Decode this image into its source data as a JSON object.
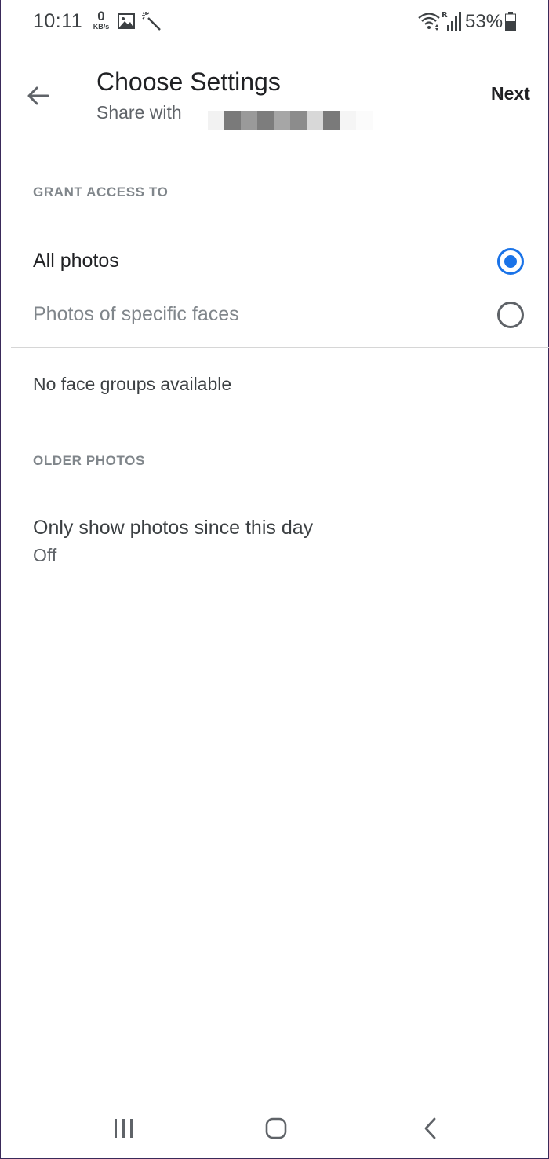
{
  "status_bar": {
    "time": "10:11",
    "net_speed_value": "0",
    "net_speed_unit": "KB/s",
    "battery_percent": "53%",
    "icons": [
      "image-icon",
      "magic-wand-icon",
      "wifi-icon",
      "signal-icon",
      "battery-icon"
    ]
  },
  "app_bar": {
    "title": "Choose Settings",
    "subtitle": "Share with",
    "next_label": "Next"
  },
  "grant_access": {
    "header": "GRANT ACCESS TO",
    "options": [
      {
        "label": "All photos",
        "selected": true
      },
      {
        "label": "Photos of specific faces",
        "selected": false
      }
    ]
  },
  "face_groups": {
    "empty_text": "No face groups available"
  },
  "older_photos": {
    "header": "OLDER PHOTOS",
    "setting_title": "Only show photos since this day",
    "setting_value": "Off"
  },
  "colors": {
    "accent": "#1a73e8",
    "text_primary": "#202124",
    "text_secondary": "#5f6368",
    "section_header": "#80868b"
  }
}
